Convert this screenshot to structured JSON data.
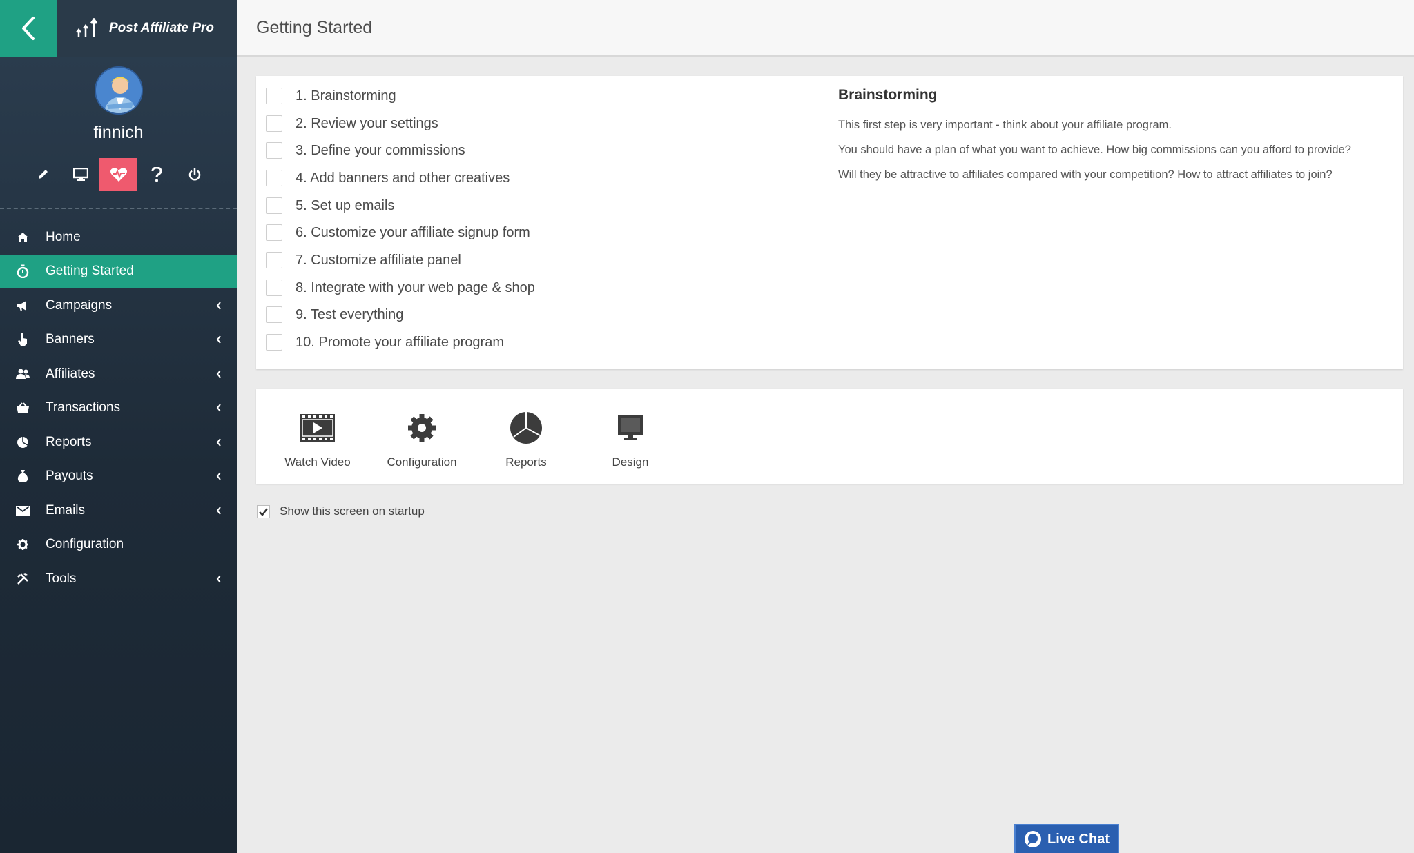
{
  "app": {
    "logo_text": "Post Affiliate Pro"
  },
  "user": {
    "name": "finnich"
  },
  "quick_icons": [
    "pencil-icon",
    "monitor-icon",
    "heart-pulse-icon",
    "question-icon",
    "power-icon"
  ],
  "nav": {
    "items": [
      {
        "label": "Home",
        "icon": "home-icon",
        "submenu": false,
        "active": false
      },
      {
        "label": "Getting Started",
        "icon": "stopwatch-icon",
        "submenu": false,
        "active": true
      },
      {
        "label": "Campaigns",
        "icon": "megaphone-icon",
        "submenu": true,
        "active": false
      },
      {
        "label": "Banners",
        "icon": "pointer-hand-icon",
        "submenu": true,
        "active": false
      },
      {
        "label": "Affiliates",
        "icon": "users-icon",
        "submenu": true,
        "active": false
      },
      {
        "label": "Transactions",
        "icon": "basket-icon",
        "submenu": true,
        "active": false
      },
      {
        "label": "Reports",
        "icon": "pie-chart-icon",
        "submenu": true,
        "active": false
      },
      {
        "label": "Payouts",
        "icon": "money-bag-icon",
        "submenu": true,
        "active": false
      },
      {
        "label": "Emails",
        "icon": "envelope-icon",
        "submenu": true,
        "active": false
      },
      {
        "label": "Configuration",
        "icon": "gear-icon",
        "submenu": false,
        "active": false
      },
      {
        "label": "Tools",
        "icon": "wrench-icon",
        "submenu": true,
        "active": false
      }
    ]
  },
  "header": {
    "title": "Getting Started"
  },
  "steps": [
    "1. Brainstorming",
    "2. Review your settings",
    "3. Define your commissions",
    "4. Add banners and other creatives",
    "5. Set up emails",
    "6. Customize your affiliate signup form",
    "7. Customize affiliate panel",
    "8. Integrate with your web page & shop",
    "9. Test everything",
    "10. Promote your affiliate program"
  ],
  "description": {
    "title": "Brainstorming",
    "lines": [
      "This first step is very important - think about your affiliate program.",
      "You should have a plan of what you want to achieve. How big commissions can you afford to provide?",
      "Will they be attractive to affiliates compared with your competition? How to attract affiliates to join?"
    ]
  },
  "tools": [
    {
      "label": "Watch Video",
      "icon": "video-icon"
    },
    {
      "label": "Configuration",
      "icon": "gear-icon"
    },
    {
      "label": "Reports",
      "icon": "pie-chart-icon"
    },
    {
      "label": "Design",
      "icon": "monitor-icon"
    }
  ],
  "startup": {
    "label": "Show this screen on startup",
    "checked": true
  },
  "livechat": {
    "label": "Live Chat"
  },
  "colors": {
    "accent": "#1fa184",
    "active_icon": "#ef5a6e",
    "livechat": "#2a5fb0"
  }
}
